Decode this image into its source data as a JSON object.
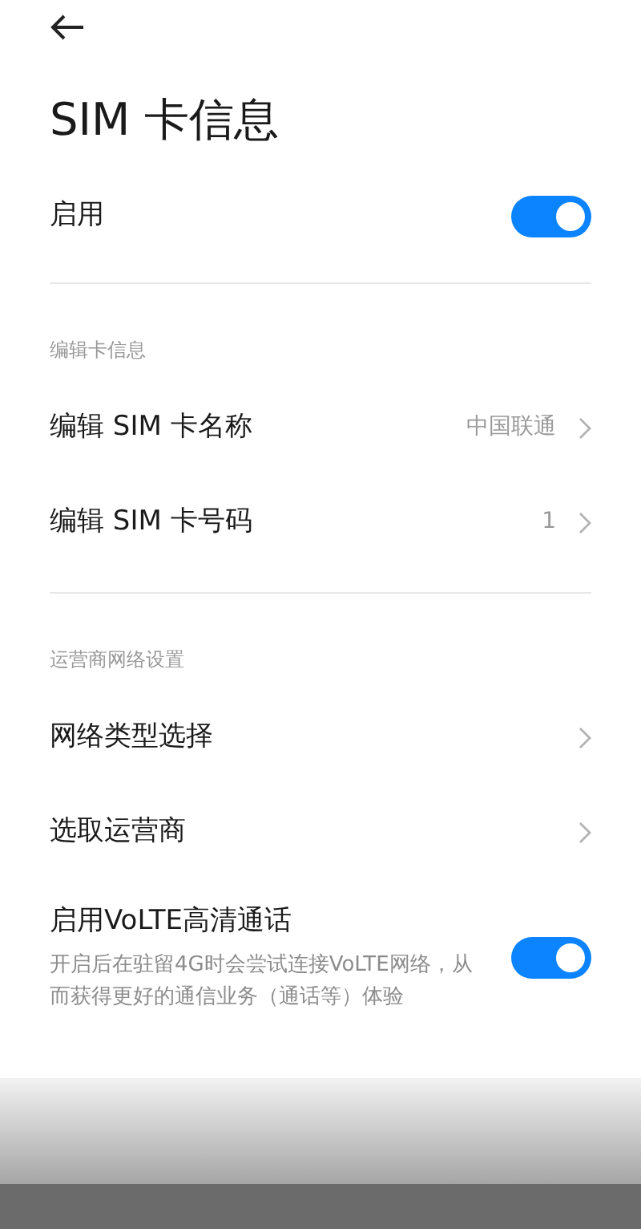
{
  "header": {
    "title": "SIM 卡信息"
  },
  "sections": [
    {
      "items": [
        {
          "kind": "toggle",
          "label": "启用",
          "on": true
        }
      ]
    },
    {
      "heading": "编辑卡信息",
      "items": [
        {
          "kind": "nav",
          "label": "编辑 SIM 卡名称",
          "value": "中国联通"
        },
        {
          "kind": "nav",
          "label": "编辑 SIM 卡号码",
          "value": "1"
        }
      ]
    },
    {
      "heading": "运营商网络设置",
      "items": [
        {
          "kind": "nav",
          "label": "网络类型选择"
        },
        {
          "kind": "nav",
          "label": "选取运营商"
        },
        {
          "kind": "toggle",
          "label": "启用VoLTE高清通话",
          "description": "开启后在驻留4G时会尝试连接VoLTE网络，从而获得更好的通信业务（通话等）体验",
          "on": true
        }
      ]
    }
  ]
}
